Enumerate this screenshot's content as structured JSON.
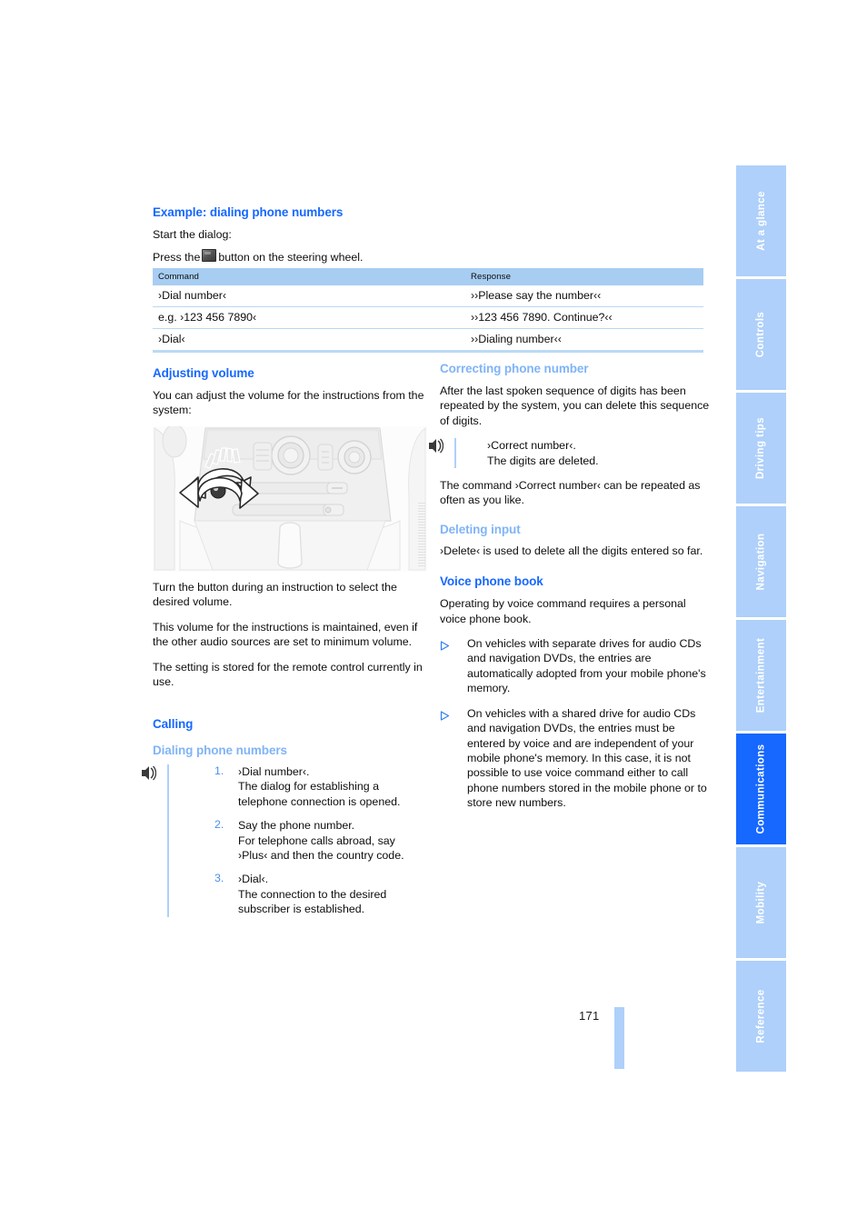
{
  "page": {
    "number": "171",
    "accent_blue": "#1668ff",
    "light_blue": "#80b4f7",
    "tab_blue": "#aed0fa",
    "table_header_blue": "#a7cdf2"
  },
  "side_tabs": [
    {
      "label": "At a glance",
      "active": false
    },
    {
      "label": "Controls",
      "active": false
    },
    {
      "label": "Driving tips",
      "active": false
    },
    {
      "label": "Navigation",
      "active": false
    },
    {
      "label": "Entertainment",
      "active": false
    },
    {
      "label": "Communications",
      "active": true
    },
    {
      "label": "Mobility",
      "active": false
    },
    {
      "label": "Reference",
      "active": false
    }
  ],
  "left_column": {
    "example_heading": "Example: dialing phone numbers",
    "start_dialog": "Start the dialog:",
    "press_button_pre": "Press the",
    "press_button_post": "button on the steering wheel.",
    "adjusting_volume": {
      "heading": "Adjusting volume",
      "intro": "You can adjust the volume for the instructions from the system:",
      "p1": "Turn the button during an instruction to select the desired volume.",
      "p2": "This volume for the instructions is maintained, even if the other audio sources are set to minimum volume.",
      "p3": "The setting is stored for the remote control currently in use."
    },
    "calling": {
      "heading": "Calling",
      "sub_heading": "Dialing phone numbers",
      "steps": [
        {
          "num": "1.",
          "line1": "›Dial number‹.",
          "line2": "The dialog for establishing a telephone connection is opened."
        },
        {
          "num": "2.",
          "line1": "Say the phone number.",
          "line2": "For telephone calls abroad, say ›Plus‹ and then the country code."
        },
        {
          "num": "3.",
          "line1": "›Dial‹.",
          "line2": "The connection to the desired subscriber is established."
        }
      ]
    }
  },
  "table": {
    "headers": [
      "Command",
      "Response"
    ],
    "rows": [
      {
        "command": "›Dial number‹",
        "response": "››Please say the number‹‹"
      },
      {
        "command": "e.g. ›123 456 7890‹",
        "response": "››123 456 7890. Continue?‹‹"
      },
      {
        "command": "›Dial‹",
        "response": "››Dialing number‹‹"
      }
    ]
  },
  "right_column": {
    "correcting": {
      "heading": "Correcting phone number",
      "p1": "After the last spoken sequence of digits has been repeated by the system, you can delete this sequence of digits.",
      "command_line1": "›Correct number‹.",
      "command_line2": "The digits are deleted.",
      "p2": "The command ›Correct number‹ can be repeated as often as you like."
    },
    "deleting": {
      "heading": "Deleting input",
      "p1": "›Delete‹ is used to delete all the digits entered so far."
    },
    "voice_phone_book": {
      "heading": "Voice phone book",
      "intro": "Operating by voice command requires a personal voice phone book.",
      "bullets": [
        "On vehicles with separate drives for audio CDs and navigation DVDs, the entries are automatically adopted from your mobile phone's memory.",
        "On vehicles with a shared drive for audio CDs and navigation DVDs, the entries must be entered by voice and are independent of your mobile phone's memory. In this case, it is not possible to use voice command either to call phone numbers stored in the mobile phone or to store new numbers."
      ]
    }
  },
  "icons": {
    "voice_command": "voice-command-icon",
    "steering_wheel_button": "steering-wheel-button-icon",
    "bullet": "triangle-bullet-icon"
  },
  "illustration": {
    "name": "center-console-volume-knob-illustration",
    "description": "Car center console line drawing with curved double arrow around the volume knob"
  }
}
